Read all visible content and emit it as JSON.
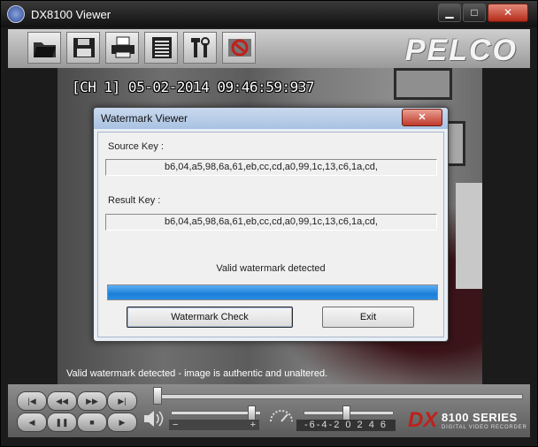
{
  "window": {
    "title": "DX8100 Viewer",
    "minimize_label": "▁",
    "maximize_label": "□",
    "close_label": "✕"
  },
  "toolbar": {
    "buttons": [
      {
        "name": "open-folder",
        "icon": "folder-open-icon"
      },
      {
        "name": "save",
        "icon": "floppy-disk-icon"
      },
      {
        "name": "print",
        "icon": "printer-icon"
      },
      {
        "name": "document",
        "icon": "document-list-icon"
      },
      {
        "name": "settings",
        "icon": "tools-icon"
      },
      {
        "name": "watermark",
        "icon": "no-sign-icon"
      }
    ],
    "brand": "PELCO"
  },
  "video": {
    "timestamp": "[CH 1] 05-02-2014 09:46:59:937",
    "status": "Valid watermark detected - image is authentic and unaltered."
  },
  "dialog": {
    "title": "Watermark Viewer",
    "close_label": "✕",
    "source_label": "Source Key :",
    "source_value": "b6,04,a5,98,6a,61,eb,cc,cd,a0,99,1c,13,c6,1a,cd,",
    "result_label": "Result Key :",
    "result_value": "b6,04,a5,98,6a,61,eb,cc,cd,a0,99,1c,13,c6,1a,cd,",
    "valid_message": "Valid watermark detected",
    "progress": 1.0,
    "watermark_check_label": "Watermark Check",
    "exit_label": "Exit"
  },
  "controls": {
    "buttons_row1": [
      {
        "name": "skip-start",
        "label": "|◀"
      },
      {
        "name": "rewind",
        "label": "◀◀"
      },
      {
        "name": "fast-forward",
        "label": "▶▶"
      },
      {
        "name": "skip-end",
        "label": "▶|"
      }
    ],
    "buttons_row2": [
      {
        "name": "play-reverse",
        "label": "◀"
      },
      {
        "name": "pause",
        "label": "❚❚"
      },
      {
        "name": "stop",
        "label": "■"
      },
      {
        "name": "play",
        "label": "▶"
      }
    ],
    "volume_minus": "−",
    "volume_plus": "+",
    "speed_scale": "-6-4-2 0 2 4 6",
    "logo_dx": "DX",
    "logo_series": "8100 SERIES",
    "logo_sub": "DIGITAL VIDEO RECORDER"
  },
  "colors": {
    "progress": "#1b7fd8",
    "brand_red": "#c0201a"
  }
}
